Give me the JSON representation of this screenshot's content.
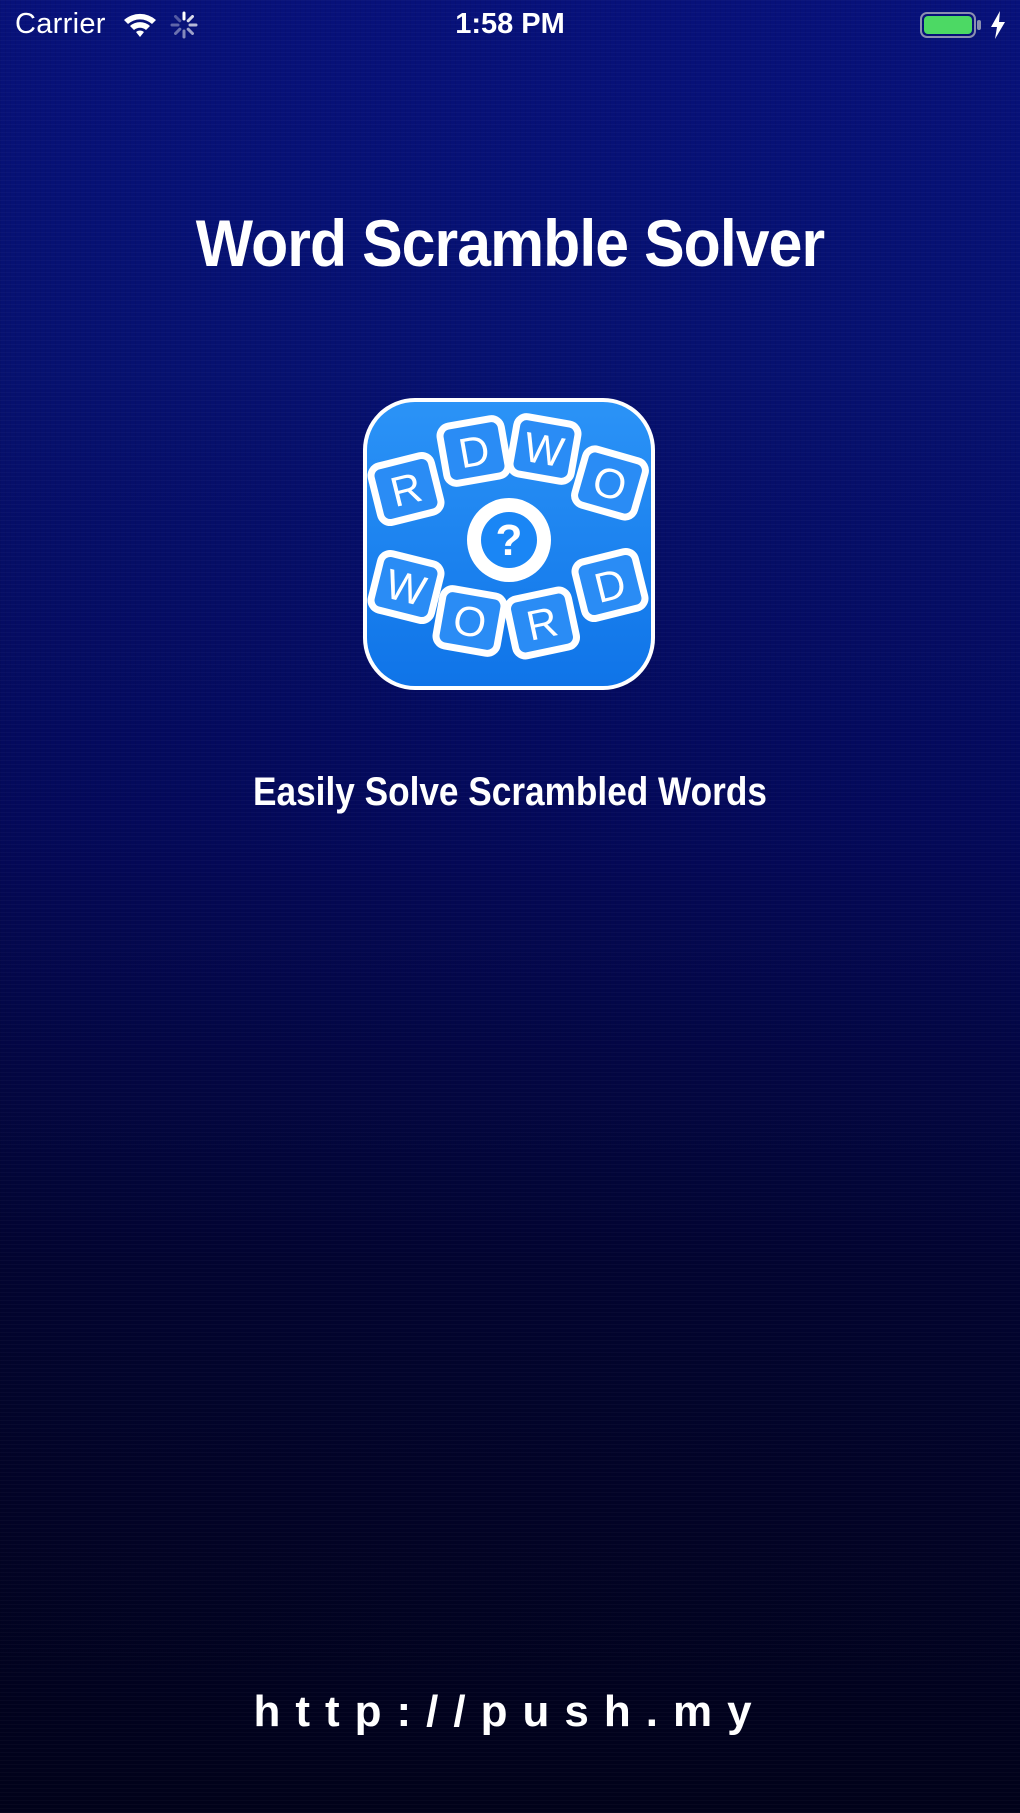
{
  "status_bar": {
    "carrier": "Carrier",
    "time": "1:58 PM",
    "wifi_icon": "wifi-icon",
    "activity_icon": "activity-spinner-icon",
    "battery_icon": "battery-full-icon",
    "charging_icon": "charging-bolt-icon",
    "battery_color": "#4cd964"
  },
  "splash": {
    "title": "Word Scramble Solver",
    "icon": {
      "name": "word-scramble-app-icon",
      "tiles": [
        "R",
        "D",
        "W",
        "O",
        "W",
        "O",
        "R",
        "D"
      ],
      "center_symbol": "?",
      "color": "#1a86f5"
    },
    "tagline": "Easily Solve Scrambled Words",
    "website": "http://push.my"
  },
  "colors": {
    "background_top": "#07117a",
    "background_bottom": "#01021a",
    "text": "#ffffff"
  }
}
